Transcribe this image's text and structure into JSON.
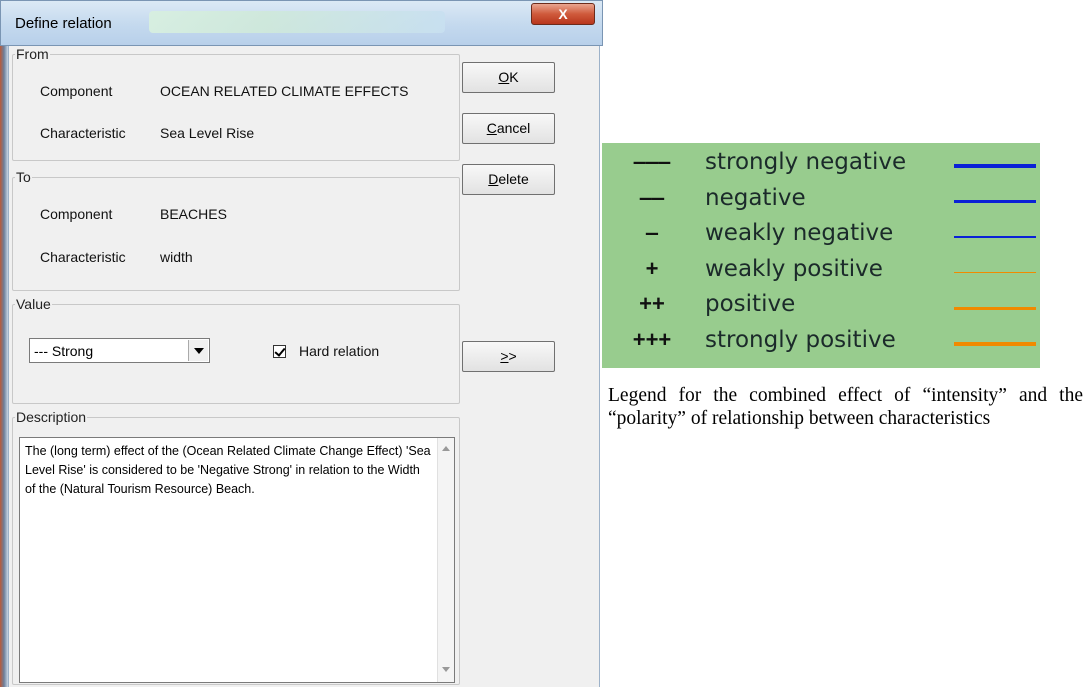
{
  "window": {
    "title": "Define relation",
    "close_glyph": "X"
  },
  "from_group": {
    "legend": "From",
    "component_label": "Component",
    "component_value": "OCEAN RELATED CLIMATE EFFECTS",
    "characteristic_label": "Characteristic",
    "characteristic_value": "Sea Level Rise"
  },
  "to_group": {
    "legend": "To",
    "component_label": "Component",
    "component_value": "BEACHES",
    "characteristic_label": "Characteristic",
    "characteristic_value": "width"
  },
  "value_group": {
    "legend": "Value",
    "selected": "--- Strong",
    "hard_relation_label": "Hard relation",
    "hard_relation_checked": true
  },
  "description_group": {
    "legend": "Description",
    "text": "The (long term) effect of the (Ocean Related Climate Change Effect) 'Sea Level Rise' is considered to be 'Negative Strong' in relation to the Width of the (Natural Tourism Resource) Beach."
  },
  "buttons": {
    "ok": {
      "mnemonic": "O",
      "rest": "K"
    },
    "cancel": {
      "mnemonic": "C",
      "rest": "ancel"
    },
    "delete": {
      "mnemonic": "D",
      "rest": "elete"
    },
    "expand": {
      "mnemonic": ">",
      "rest": ">"
    }
  },
  "legend_panel": {
    "background": "#98cc8e",
    "rows": [
      {
        "symbol": "---",
        "label": "strongly negative",
        "color": "#0a21d6",
        "weight": "strong"
      },
      {
        "symbol": "--",
        "label": "negative",
        "color": "#0a21d6",
        "weight": "medium"
      },
      {
        "symbol": "-",
        "label": "weakly negative",
        "color": "#0a21d6",
        "weight": "weak"
      },
      {
        "symbol": "+",
        "label": "weakly positive",
        "color": "#f08a00",
        "weight": "weak"
      },
      {
        "symbol": "++",
        "label": "positive",
        "color": "#f08a00",
        "weight": "medium"
      },
      {
        "symbol": "+++",
        "label": "strongly positive",
        "color": "#f08a00",
        "weight": "strong"
      }
    ]
  },
  "caption": "Legend for the combined effect of “intensity” and the “polarity” of relationship between characteristics"
}
